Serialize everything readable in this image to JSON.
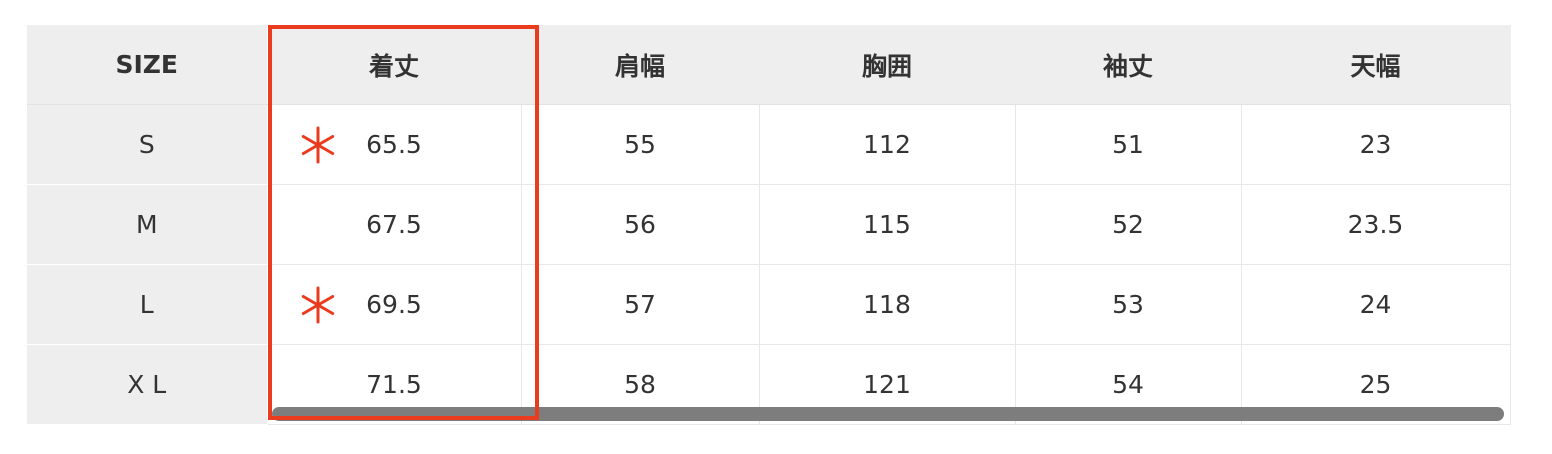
{
  "table": {
    "headers": [
      "SIZE",
      "着丈",
      "肩幅",
      "胸囲",
      "袖丈",
      "天幅"
    ],
    "rows": [
      {
        "size": "S",
        "cells": [
          "65.5",
          "55",
          "112",
          "51",
          "23"
        ]
      },
      {
        "size": "M",
        "cells": [
          "67.5",
          "56",
          "115",
          "52",
          "23.5"
        ]
      },
      {
        "size": "L",
        "cells": [
          "69.5",
          "57",
          "118",
          "53",
          "24"
        ]
      },
      {
        "size": "X L",
        "cells": [
          "71.5",
          "58",
          "121",
          "54",
          "25"
        ]
      }
    ]
  },
  "annotations": {
    "asterisk_rows": [
      "S",
      "L"
    ],
    "highlight_color": "#ea3b1f"
  },
  "colors": {
    "header_bg": "#eeeeee",
    "scrollbar": "#7d7d7d"
  }
}
